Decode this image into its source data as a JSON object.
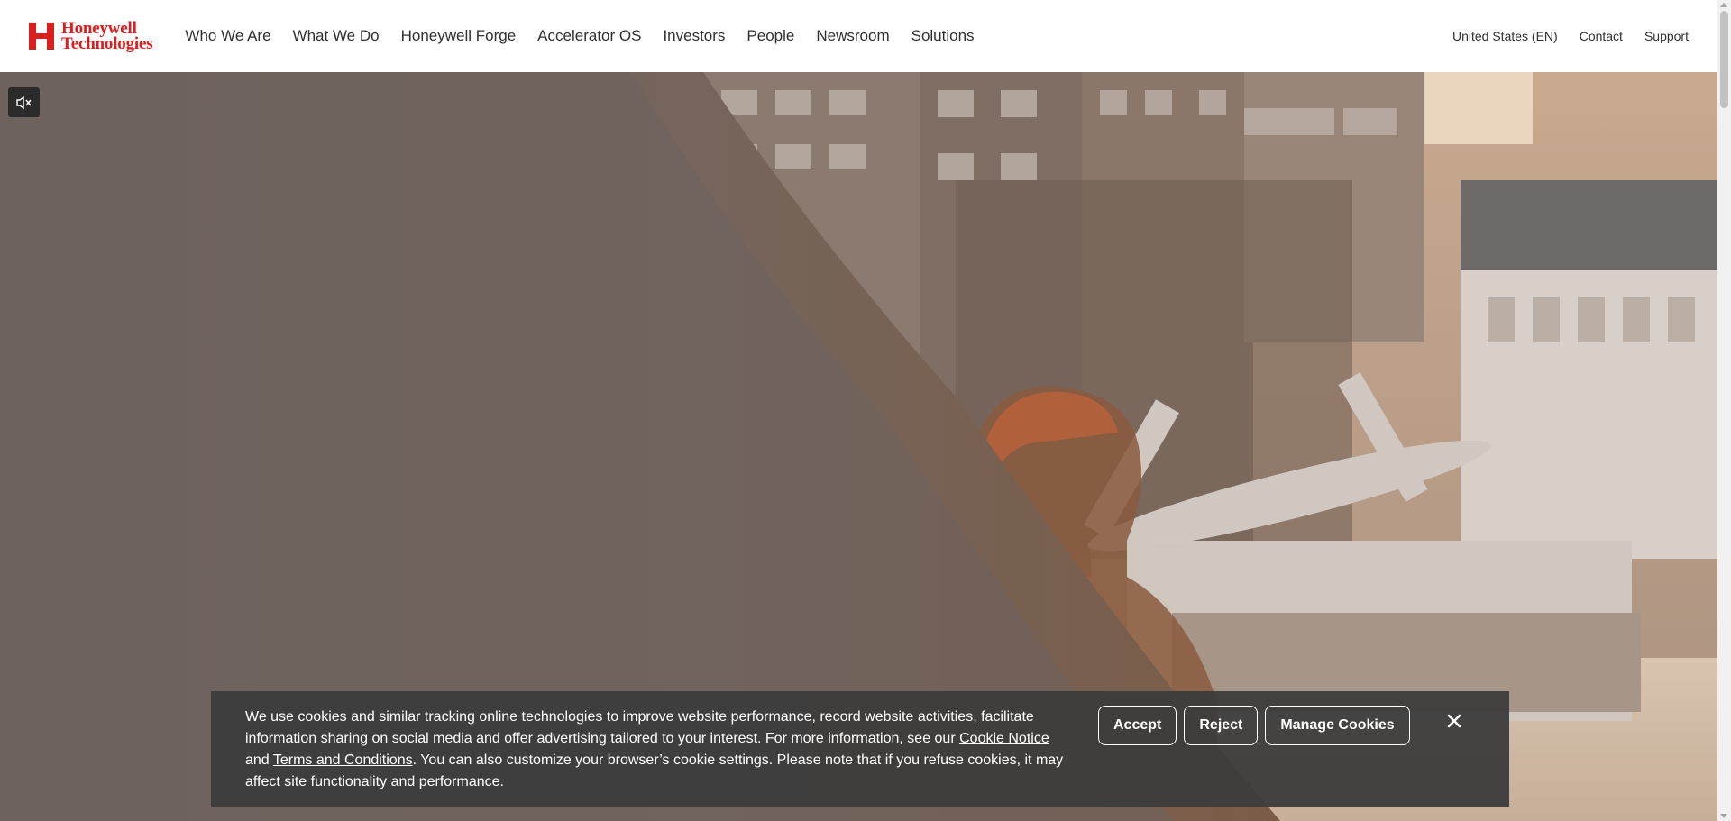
{
  "header": {
    "logo_line1": "Honeywell",
    "logo_line2": "Technologies",
    "nav": [
      {
        "label": "Who We Are"
      },
      {
        "label": "What We Do"
      },
      {
        "label": "Honeywell Forge"
      },
      {
        "label": "Accelerator OS"
      },
      {
        "label": "Investors"
      },
      {
        "label": "People"
      },
      {
        "label": "Newsroom"
      },
      {
        "label": "Solutions"
      }
    ],
    "region": "United States (EN)",
    "contact": "Contact",
    "support": "Support"
  },
  "hero": {
    "mute_icon": "speaker-muted-icon"
  },
  "cookie": {
    "text_part1": "We use cookies and similar tracking online technologies to improve website performance, record website activities, facilitate information sharing on social media and offer advertising tailored to your interest. For more information, see our ",
    "link_cookie": "Cookie Notice",
    "text_and": " and ",
    "link_terms": "Terms and Conditions",
    "text_part2": ". You can also customize your browser’s cookie settings. Please note that if you refuse cookies, it may affect site functionality and performance.",
    "accept": "Accept",
    "reject": "Reject",
    "manage": "Manage Cookies",
    "close_icon": "close-icon"
  },
  "colors": {
    "brand_red": "#dc1e1e",
    "banner_bg": "#3c3c3c"
  }
}
